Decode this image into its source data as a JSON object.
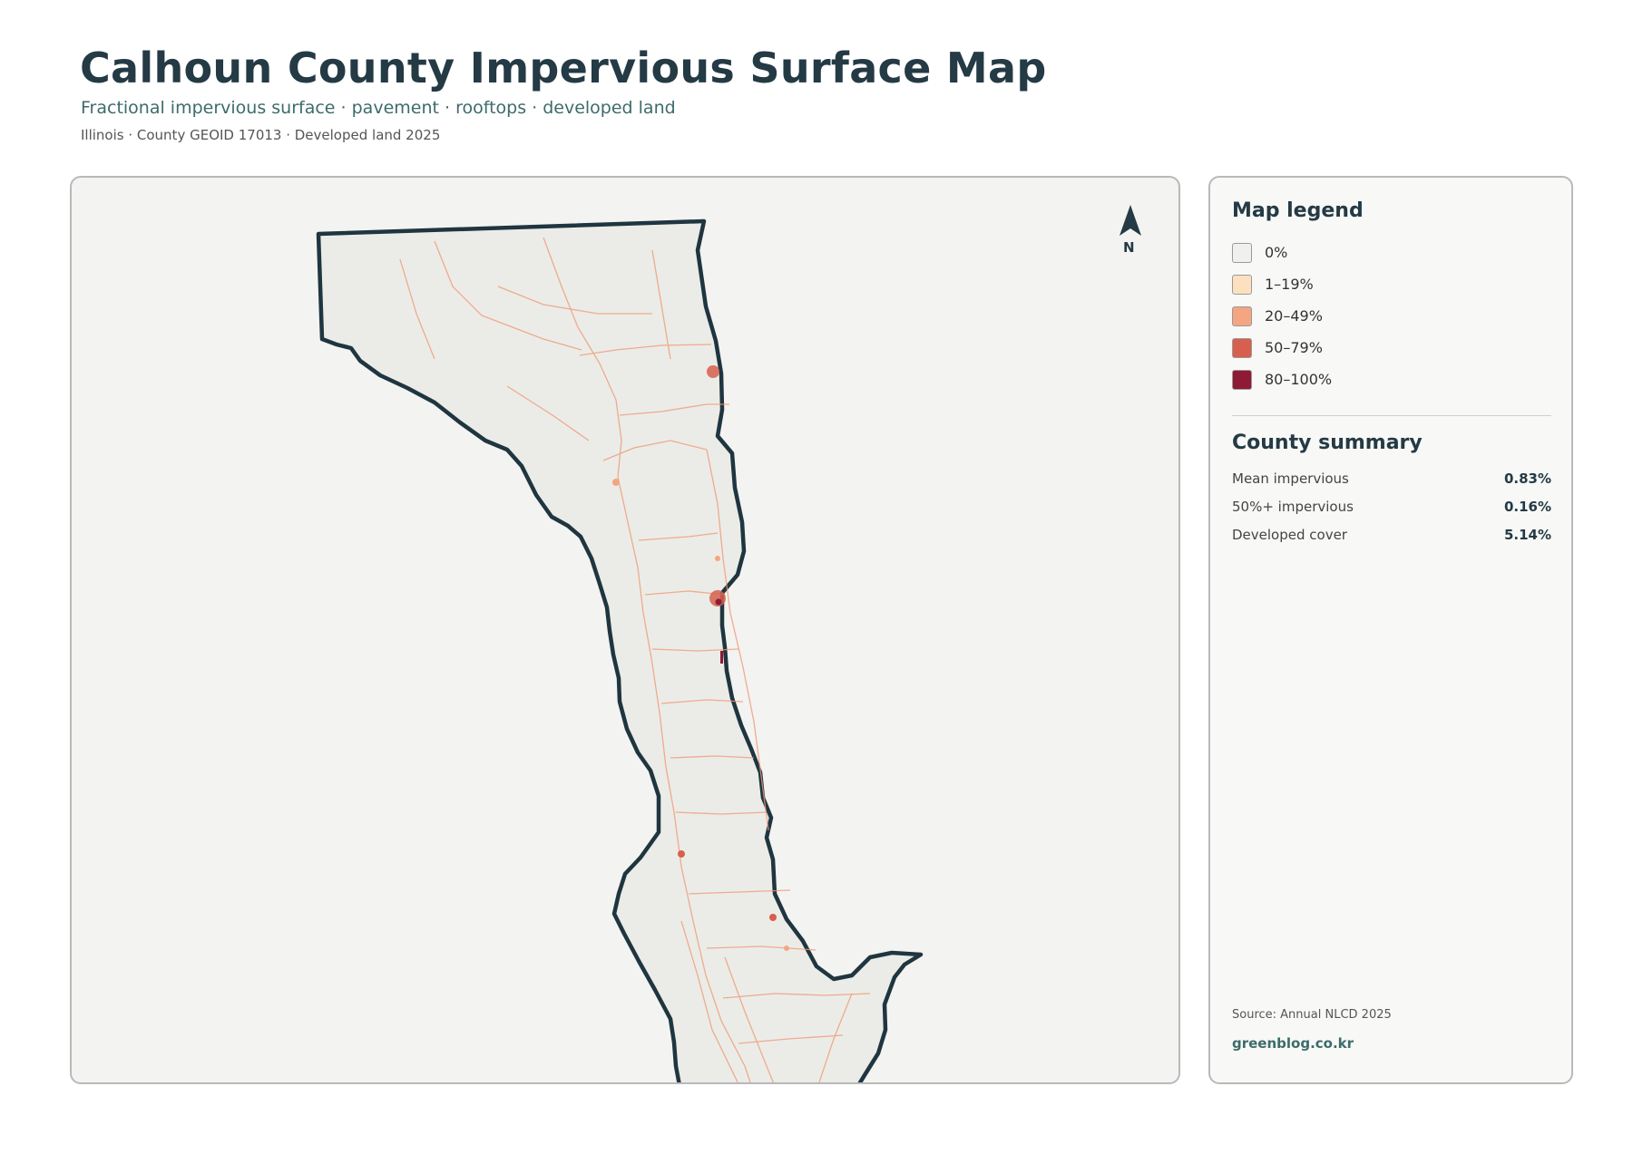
{
  "header": {
    "title": "Calhoun County Impervious Surface Map",
    "subtitle": "Fractional impervious surface · pavement · rooftops · developed land",
    "meta": "Illinois · County GEOID 17013 · Developed land 2025"
  },
  "map": {
    "north_label": "N",
    "north_icon": "north-arrow-icon",
    "boundary_color": "#1f3540",
    "fill_color": "#ebece7",
    "road_color": "#f09a78"
  },
  "legend": {
    "title": "Map legend",
    "items": [
      {
        "label": "0%",
        "color": "#f0f0ee"
      },
      {
        "label": "1–19%",
        "color": "#fde0c0"
      },
      {
        "label": "20–49%",
        "color": "#f4a582"
      },
      {
        "label": "50–79%",
        "color": "#d6604d"
      },
      {
        "label": "80–100%",
        "color": "#8e1a35"
      }
    ]
  },
  "summary": {
    "title": "County summary",
    "rows": [
      {
        "label": "Mean impervious",
        "value": "0.83%"
      },
      {
        "label": "50%+ impervious",
        "value": "0.16%"
      },
      {
        "label": "Developed cover",
        "value": "5.14%"
      }
    ]
  },
  "footer": {
    "source": "Source: Annual NLCD 2025",
    "brand": "greenblog.co.kr"
  }
}
